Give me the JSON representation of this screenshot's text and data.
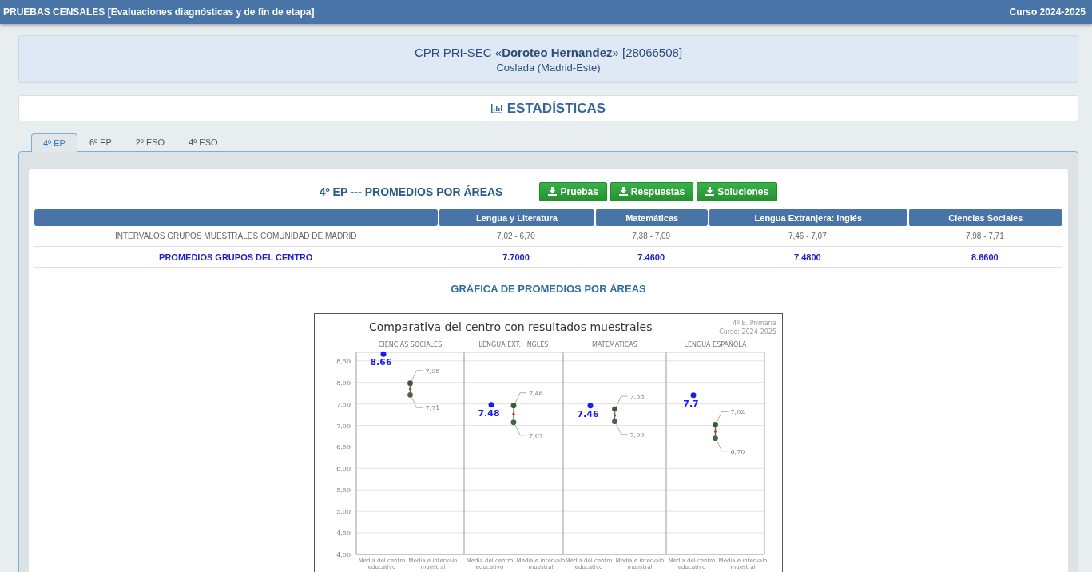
{
  "header": {
    "title": "PRUEBAS CENSALES [Evaluaciones diagnósticas y de fin de etapa]",
    "course": "Curso 2024-2025"
  },
  "school": {
    "name": "CPR PRI-SEC «**Doroteo Hernandez**» [28066508]",
    "location": "Coslada (Madrid-Este)"
  },
  "section_title": "ESTADÍSTICAS",
  "tabs": [
    {
      "label": "4º EP",
      "selected": true
    },
    {
      "label": "6º EP",
      "selected": false
    },
    {
      "label": "2º ESO",
      "selected": false
    },
    {
      "label": "4º ESO",
      "selected": false
    }
  ],
  "panel": {
    "title": "4º EP --- PROMEDIOS POR ÁREAS",
    "buttons": [
      "Pruebas",
      "Respuestas",
      "Soluciones"
    ],
    "table": {
      "columns": [
        "Lengua y Literatura",
        "Matemáticas",
        "Lengua Extranjera: Inglés",
        "Ciencias Sociales"
      ],
      "rows": [
        {
          "kind": "interval",
          "label": "INTERVALOS GRUPOS MUESTRALES COMUNIDAD DE MADRID",
          "cells": [
            "7,02 - 6,70",
            "7,38 - 7,09",
            "7,46 - 7,07",
            "7,98 - 7,71"
          ]
        },
        {
          "kind": "average",
          "label": "PROMEDIOS GRUPOS DEL CENTRO",
          "cells": [
            "7.7000",
            "7.4600",
            "7.4800",
            "8.6600"
          ]
        }
      ]
    },
    "chart_heading": "GRÁFICA DE PROMEDIOS POR ÁREAS",
    "chart": {
      "subtitle": [
        "4º E. Primaria",
        "Curso: 2024-2025"
      ],
      "center_labels": [
        "8.66",
        "7.48",
        "7.46",
        "7.7"
      ],
      "upper_labels": [
        "7,98",
        "7,46",
        "7,38",
        "7,02"
      ],
      "lower_labels": [
        "7,71",
        "7,07",
        "7,09",
        "6,70"
      ],
      "x_labels": [
        "Media del centro educativo",
        "Media e intervalo muestral",
        "Media del centro educativo",
        "Media e intervalo muestral",
        "Media del centro educativo",
        "Media e intervalo muestral",
        "Media del centro educativo",
        "Media e intervalo muestral"
      ],
      "chart_data": {
        "type": "scatter",
        "title": "Comparativa del centro con resultados muestrales",
        "categories": [
          "CIENCIAS SOCIALES",
          "LENGUA EXT.: INGLÉS",
          "MATEMÁTICAS",
          "LENGUA ESPAÑOLA"
        ],
        "series": [
          {
            "color": "#1a1aff",
            "values": [
              8.66,
              7.48,
              7.46,
              7.7
            ]
          },
          {
            "color": "#3d5a3d",
            "values": [
              7.98,
              7.46,
              7.38,
              7.02
            ]
          },
          {
            "color": "#466446",
            "values": [
              7.71,
              7.07,
              7.09,
              6.7
            ]
          }
        ],
        "ylim": [
          4,
          8.7
        ],
        "grid": true,
        "yticks": [
          {
            "value": 4,
            "label": "4,00"
          },
          {
            "value": 4.5,
            "label": "4,50"
          },
          {
            "value": 5,
            "label": "5,00"
          },
          {
            "value": 5.5,
            "label": "5,50"
          },
          {
            "value": 6,
            "label": "6,00"
          },
          {
            "value": 6.5,
            "label": "6,50"
          },
          {
            "value": 7,
            "label": "7,00"
          },
          {
            "value": 7.5,
            "label": "7,50"
          },
          {
            "value": 8,
            "label": "8,00"
          },
          {
            "value": 8.5,
            "label": "8,50"
          }
        ]
      }
    }
  }
}
